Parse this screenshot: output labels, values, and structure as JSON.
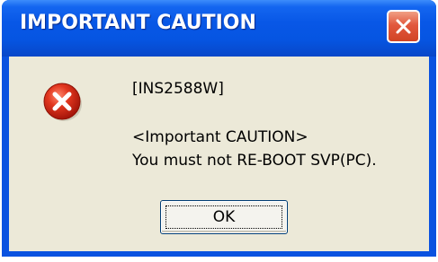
{
  "dialog": {
    "title": "IMPORTANT CAUTION",
    "code": "[INS2588W]",
    "heading": "<Important CAUTION>",
    "message": "You must not RE-BOOT SVP(PC).",
    "ok_label": "OK",
    "icon": "error-icon"
  },
  "colors": {
    "titlebar": "#0655e2",
    "client": "#ece9d8",
    "close_button": "#e2583d",
    "error_icon": "#d8261b"
  }
}
